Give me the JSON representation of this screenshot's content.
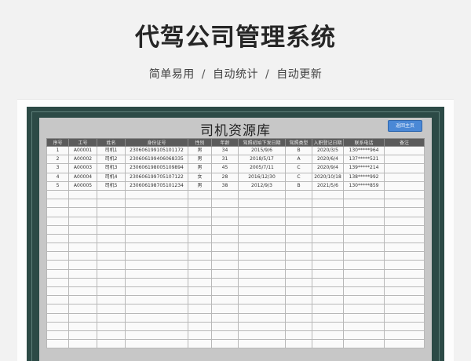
{
  "header": {
    "title": "代驾公司管理系统",
    "tags": [
      "简单易用",
      "自动统计",
      "自动更新"
    ],
    "separator": "/"
  },
  "sheet": {
    "title": "司机资源库",
    "home_button": "返回主页",
    "columns": [
      "序号",
      "工号",
      "姓名",
      "身份证号",
      "性别",
      "年龄",
      "驾照初始下发日期",
      "驾照类型",
      "入职登记日期",
      "联系电话",
      "备注"
    ],
    "rows": [
      [
        "1",
        "A00001",
        "司机1",
        "230606199105101172",
        "男",
        "34",
        "2015/9/6",
        "B",
        "2020/3/5",
        "130*****964",
        ""
      ],
      [
        "2",
        "A00002",
        "司机2",
        "230606199406068335",
        "男",
        "31",
        "2018/5/17",
        "A",
        "2020/6/4",
        "137*****521",
        ""
      ],
      [
        "3",
        "A00003",
        "司机3",
        "230606198005109894",
        "男",
        "45",
        "2005/7/11",
        "C",
        "2020/9/4",
        "139*****214",
        ""
      ],
      [
        "4",
        "A00004",
        "司机4",
        "230606199705107122",
        "女",
        "28",
        "2016/12/30",
        "C",
        "2020/10/18",
        "138*****992",
        ""
      ],
      [
        "5",
        "A00005",
        "司机5",
        "230606198705101234",
        "男",
        "38",
        "2012/9/3",
        "B",
        "2021/5/6",
        "130*****859",
        ""
      ]
    ],
    "empty_row_count": 18
  },
  "colors": {
    "frame": "#2c4a46",
    "header_fill": "#5b5b5b",
    "button": "#4a88d6"
  }
}
